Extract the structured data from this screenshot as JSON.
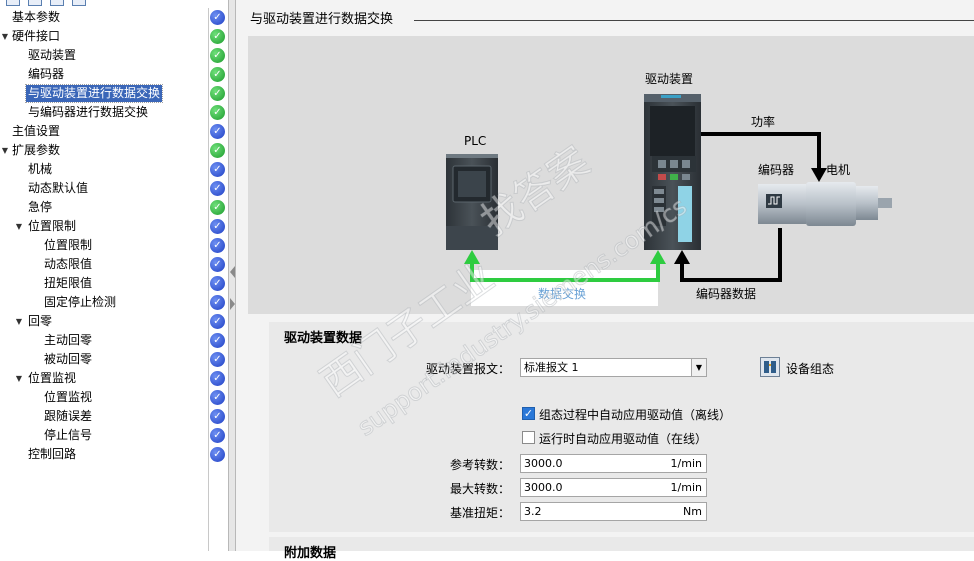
{
  "tree": {
    "items": [
      {
        "label": "基本参数",
        "status": "blue"
      },
      {
        "label": "硬件接口",
        "status": "green",
        "expander": "▼"
      },
      {
        "label": "驱动装置",
        "status": "green"
      },
      {
        "label": "编码器",
        "status": "green"
      },
      {
        "label": "与驱动装置进行数据交换",
        "status": "green",
        "selected": true
      },
      {
        "label": "与编码器进行数据交换",
        "status": "green"
      },
      {
        "label": "主值设置",
        "status": "blue"
      },
      {
        "label": "扩展参数",
        "status": "green",
        "expander": "▼"
      },
      {
        "label": "机械",
        "status": "blue"
      },
      {
        "label": "动态默认值",
        "status": "blue"
      },
      {
        "label": "急停",
        "status": "green"
      },
      {
        "label": "位置限制",
        "status": "blue",
        "expander": "▼"
      },
      {
        "label": "位置限制",
        "status": "blue"
      },
      {
        "label": "动态限值",
        "status": "blue"
      },
      {
        "label": "扭矩限值",
        "status": "blue"
      },
      {
        "label": "固定停止检测",
        "status": "blue"
      },
      {
        "label": "回零",
        "status": "blue",
        "expander": "▼"
      },
      {
        "label": "主动回零",
        "status": "blue"
      },
      {
        "label": "被动回零",
        "status": "blue"
      },
      {
        "label": "位置监视",
        "status": "blue",
        "expander": "▼"
      },
      {
        "label": "位置监视",
        "status": "blue"
      },
      {
        "label": "跟随误差",
        "status": "blue"
      },
      {
        "label": "停止信号",
        "status": "blue"
      },
      {
        "label": "控制回路",
        "status": "blue"
      }
    ],
    "status_check": "✓"
  },
  "section": {
    "title": "与驱动装置进行数据交换"
  },
  "diagram": {
    "plc_label": "PLC",
    "drive_label": "驱动装置",
    "power_label": "功率",
    "encoder_label": "编码器",
    "motor_label": "电机",
    "data_exchange_label": "数据交换",
    "encoder_data_label": "编码器数据"
  },
  "drive_data": {
    "heading": "驱动装置数据",
    "telegram_label": "驱动装置报文：",
    "telegram_value": "标准报文 1",
    "device_config_label": "设备组态",
    "auto_apply_offline_label": "组态过程中自动应用驱动值（离线）",
    "auto_apply_offline_checked": true,
    "auto_apply_online_label": "运行时自动应用驱动值（在线）",
    "auto_apply_online_checked": false,
    "ref_speed_label": "参考转数：",
    "ref_speed_value": "3000.0",
    "ref_speed_unit": "1/min",
    "max_speed_label": "最大转数：",
    "max_speed_value": "3000.0",
    "max_speed_unit": "1/min",
    "ref_torque_label": "基准扭矩：",
    "ref_torque_value": "3.2",
    "ref_torque_unit": "Nm"
  },
  "extra": {
    "heading": "附加数据"
  },
  "watermark": {
    "line1": "西门子工业",
    "line2": "找答案",
    "line3": "support.industry.siemens.com/cs"
  },
  "colors": {
    "selection": "#3a66b8",
    "status_blue": "#2d4fd6",
    "status_green": "#22a832",
    "data_arrow": "#2ecc40",
    "power_arrow": "#000000"
  }
}
